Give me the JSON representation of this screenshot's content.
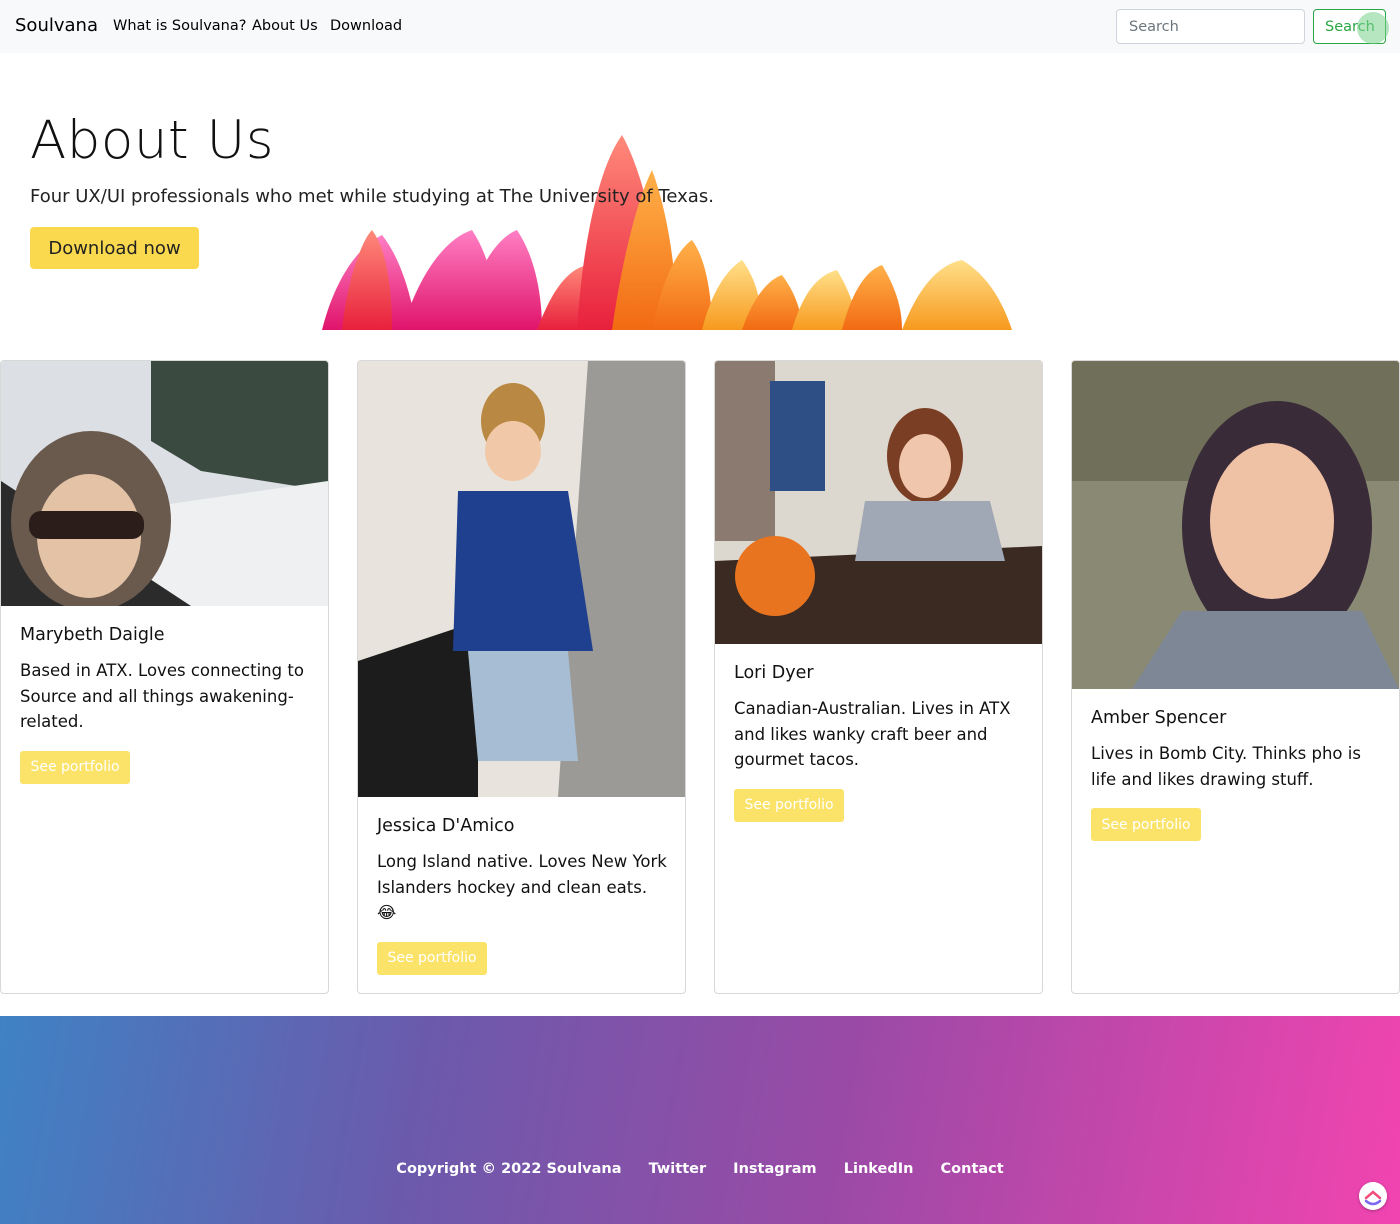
{
  "navbar": {
    "brand": "Soulvana",
    "links": [
      "What is Soulvana?",
      "About Us",
      "Download"
    ],
    "search_placeholder": "Search",
    "search_button": "Search"
  },
  "hero": {
    "title": "About Us",
    "subtitle": "Four UX/UI professionals who met while studying at The University of Texas.",
    "button": "Download now"
  },
  "team": [
    {
      "name": "Marybeth Daigle",
      "bio": "Based in ATX. Loves connecting to Source and all things awakening-related.",
      "button": "See portfolio"
    },
    {
      "name": "Jessica D'Amico",
      "bio": "Long Island native. Loves New York Islanders hockey and clean eats. 😂",
      "button": "See portfolio"
    },
    {
      "name": "Lori Dyer",
      "bio": "Canadian-Australian. Lives in ATX and likes wanky craft beer and gourmet tacos.",
      "button": "See portfolio"
    },
    {
      "name": "Amber Spencer",
      "bio": "Lives in Bomb City. Thinks pho is life and likes drawing stuff.",
      "button": "See portfolio"
    }
  ],
  "footer": {
    "copyright": "Copyright © 2022 Soulvana",
    "links": [
      "Twitter",
      "Instagram",
      "LinkedIn",
      "Contact"
    ]
  },
  "colors": {
    "accent_yellow": "#fbd94f",
    "search_green": "#28a745",
    "footer_gradient_start": "#3f82c4",
    "footer_gradient_end": "#f244b0"
  }
}
